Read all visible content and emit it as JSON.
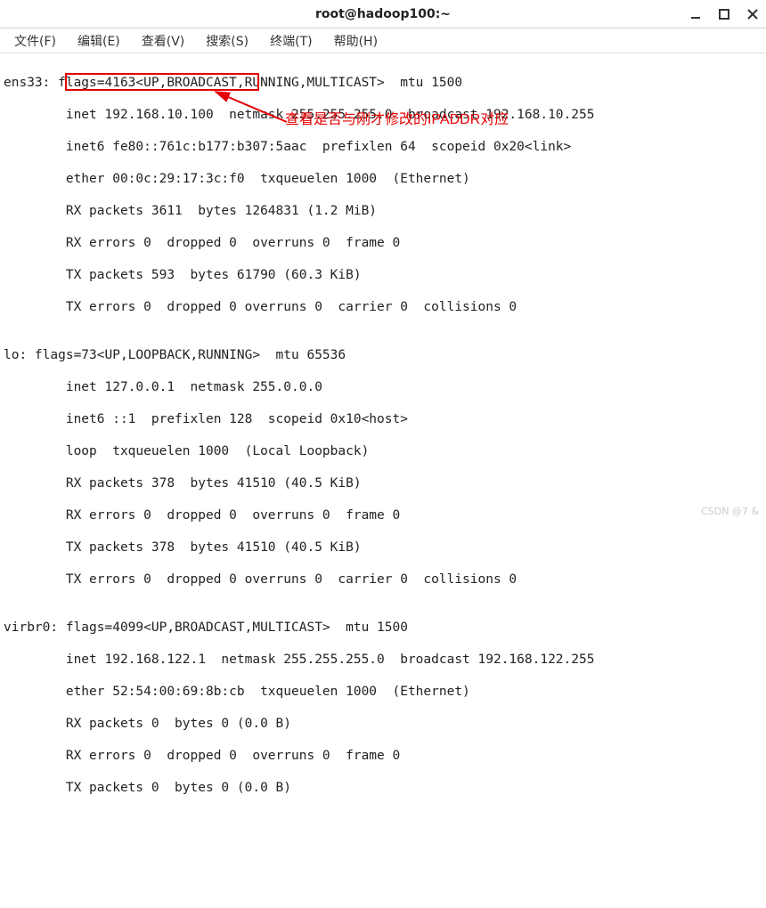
{
  "window": {
    "title": "root@hadoop100:~"
  },
  "menu": {
    "file": "文件(F)",
    "edit": "编辑(E)",
    "view": "查看(V)",
    "search": "搜索(S)",
    "terminal": "终端(T)",
    "help": "帮助(H)"
  },
  "annotation": {
    "text": "查看是否与刚才修改的IPADDR对应"
  },
  "term": {
    "l1": "ens33: flags=4163<UP,BROADCAST,RUNNING,MULTICAST>  mtu 1500",
    "l2": "        inet 192.168.10.100  netmask 255.255.255.0  broadcast 192.168.10.255",
    "l3": "        inet6 fe80::761c:b177:b307:5aac  prefixlen 64  scopeid 0x20<link>",
    "l4": "        ether 00:0c:29:17:3c:f0  txqueuelen 1000  (Ethernet)",
    "l5": "        RX packets 3611  bytes 1264831 (1.2 MiB)",
    "l6": "        RX errors 0  dropped 0  overruns 0  frame 0",
    "l7": "        TX packets 593  bytes 61790 (60.3 KiB)",
    "l8": "        TX errors 0  dropped 0 overruns 0  carrier 0  collisions 0",
    "l9": "",
    "l10": "lo: flags=73<UP,LOOPBACK,RUNNING>  mtu 65536",
    "l11": "        inet 127.0.0.1  netmask 255.0.0.0",
    "l12": "        inet6 ::1  prefixlen 128  scopeid 0x10<host>",
    "l13": "        loop  txqueuelen 1000  (Local Loopback)",
    "l14": "        RX packets 378  bytes 41510 (40.5 KiB)",
    "l15": "        RX errors 0  dropped 0  overruns 0  frame 0",
    "l16": "        TX packets 378  bytes 41510 (40.5 KiB)",
    "l17": "        TX errors 0  dropped 0 overruns 0  carrier 0  collisions 0",
    "l18": "",
    "l19": "virbr0: flags=4099<UP,BROADCAST,MULTICAST>  mtu 1500",
    "l20": "        inet 192.168.122.1  netmask 255.255.255.0  broadcast 192.168.122.255",
    "l21": "        ether 52:54:00:69:8b:cb  txqueuelen 1000  (Ethernet)",
    "l22": "        RX packets 0  bytes 0 (0.0 B)",
    "l23": "        RX errors 0  dropped 0  overruns 0  frame 0",
    "l24": "        TX packets 0  bytes 0 (0.0 B)"
  },
  "watermark": "CSDN @7 &"
}
